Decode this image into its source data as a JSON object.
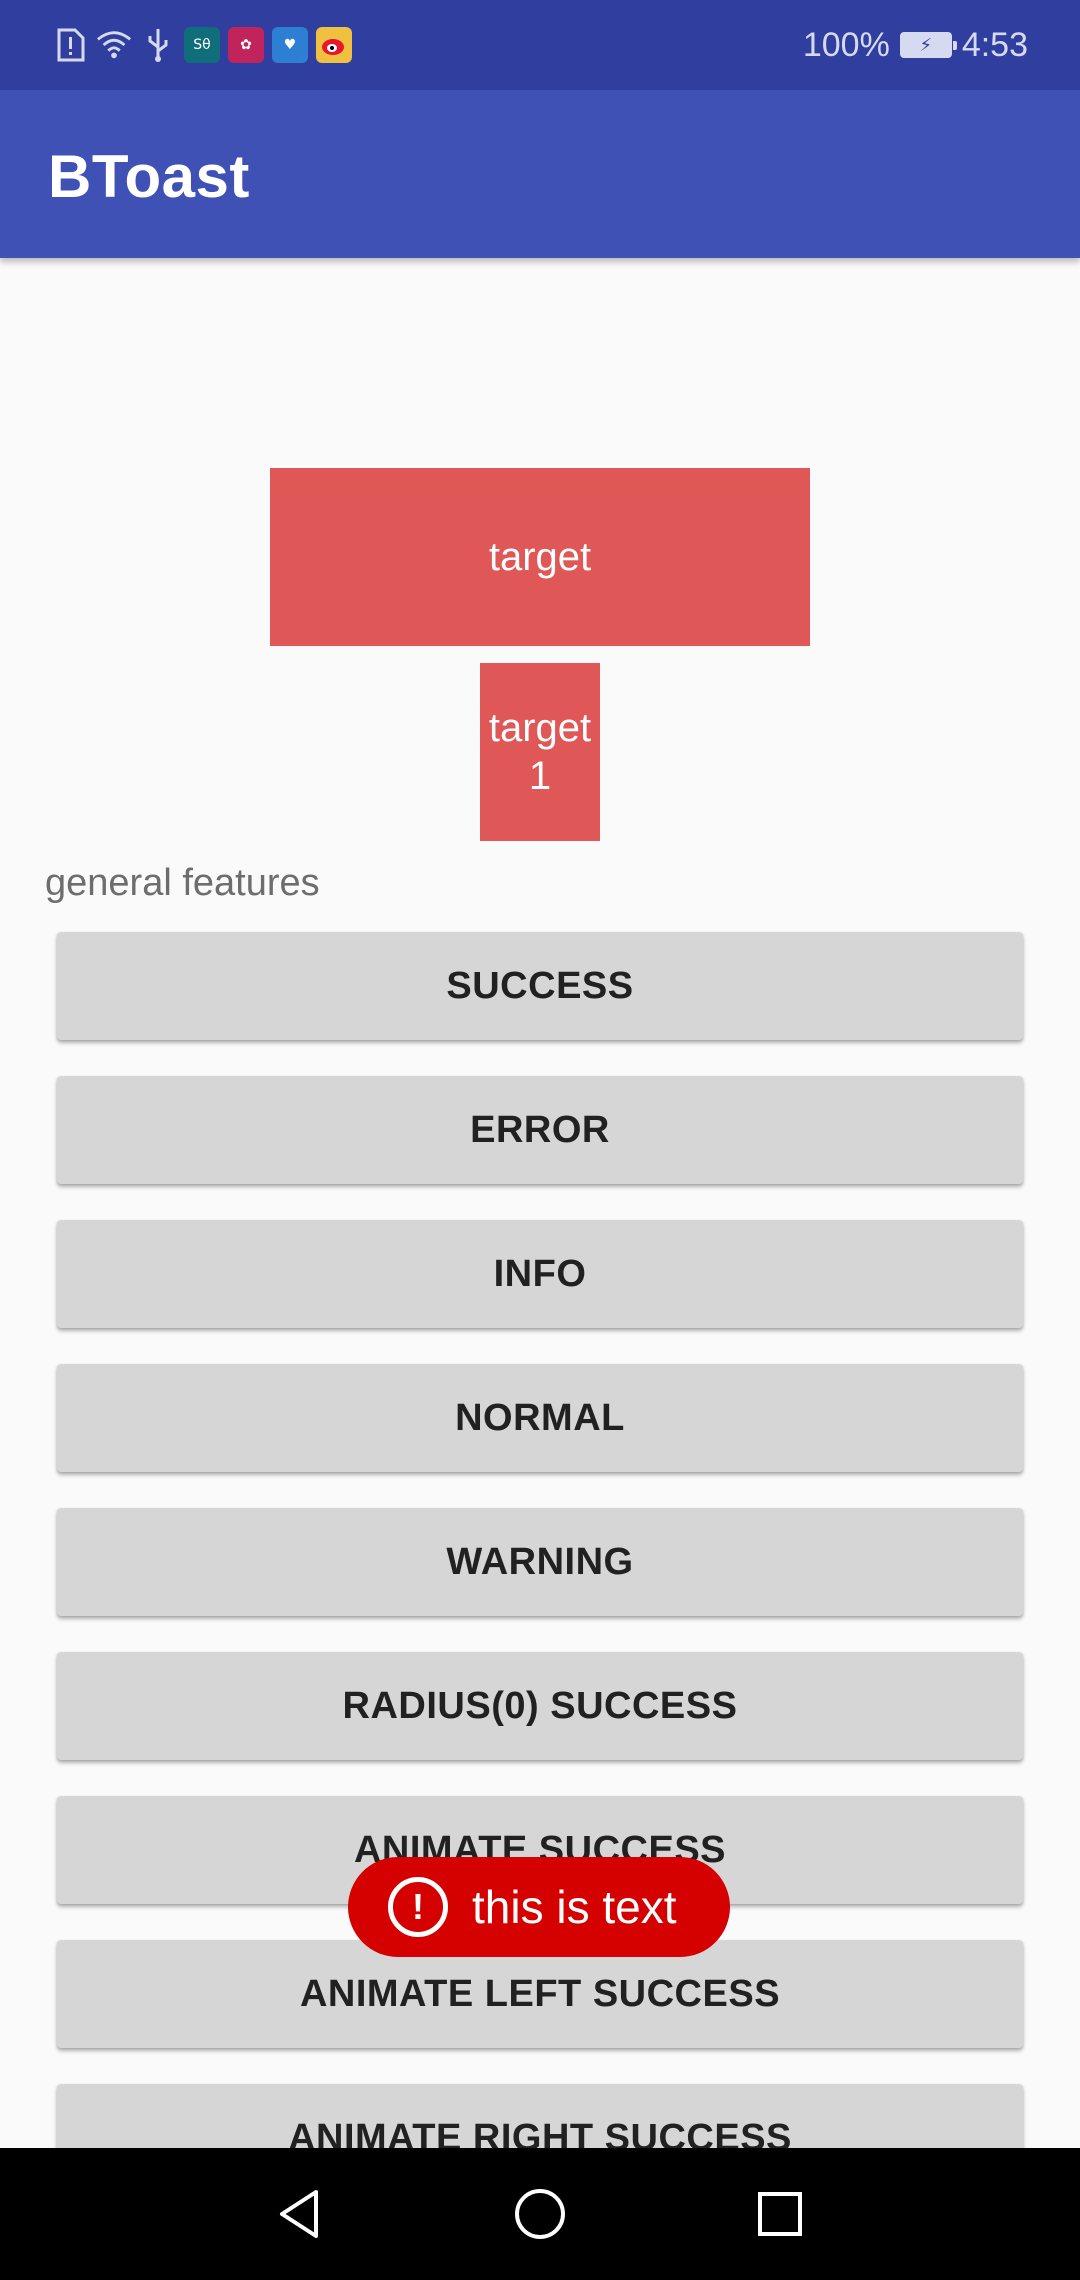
{
  "status_bar": {
    "battery_percent": "100%",
    "time": "4:53",
    "battery_level": 1.0,
    "icons": [
      "alert-icon",
      "wifi-icon",
      "usb-icon",
      "app-icon-1",
      "huawei-icon",
      "app-icon-3",
      "weibo-icon"
    ]
  },
  "app_bar": {
    "title": "BToast"
  },
  "targets": {
    "main_label": "target",
    "small_label": "target\n1"
  },
  "section": {
    "label": "general features"
  },
  "buttons": [
    "SUCCESS",
    "ERROR",
    "INFO",
    "NORMAL",
    "WARNING",
    "RADIUS(0) SUCCESS",
    "ANIMATE SUCCESS",
    "ANIMATE LEFT SUCCESS",
    "ANIMATE RIGHT SUCCESS"
  ],
  "toast": {
    "text": "this is text",
    "icon": "exclamation-icon",
    "color": "#d50000"
  },
  "colors": {
    "status_bar": "#303f9f",
    "app_bar": "#3f51b5",
    "target": "#e05757",
    "button": "#d6d6d6",
    "nav_bar": "#000000"
  },
  "nav": {
    "icons": [
      "back-icon",
      "home-icon",
      "recents-icon"
    ]
  }
}
